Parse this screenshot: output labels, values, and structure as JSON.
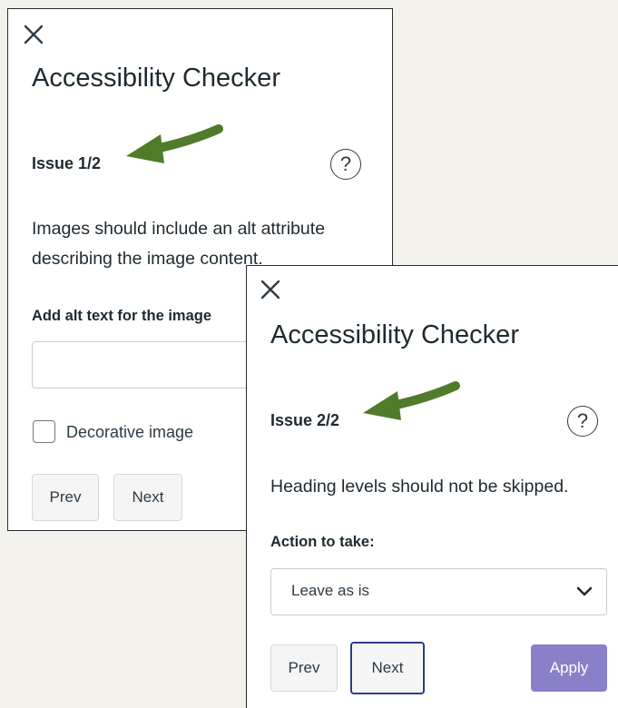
{
  "panel_1": {
    "title": "Accessibility Checker",
    "issue_label": "Issue 1/2",
    "help_symbol": "?",
    "description": "Images should include an alt attribute describing the image content.",
    "alt_text_label": "Add alt text for the image",
    "alt_text_value": "",
    "decorative_label": "Decorative image",
    "decorative_checked": false,
    "prev_label": "Prev",
    "next_label": "Next"
  },
  "panel_2": {
    "title": "Accessibility Checker",
    "issue_label": "Issue 2/2",
    "help_symbol": "?",
    "description": "Heading levels should not be skipped.",
    "action_label": "Action to take:",
    "action_value": "Leave as is",
    "prev_label": "Prev",
    "next_label": "Next",
    "apply_label": "Apply"
  },
  "colors": {
    "arrow_green": "#4f7b2a",
    "apply_button": "#8a7fc9",
    "focus_ring": "#2b3a8c"
  }
}
